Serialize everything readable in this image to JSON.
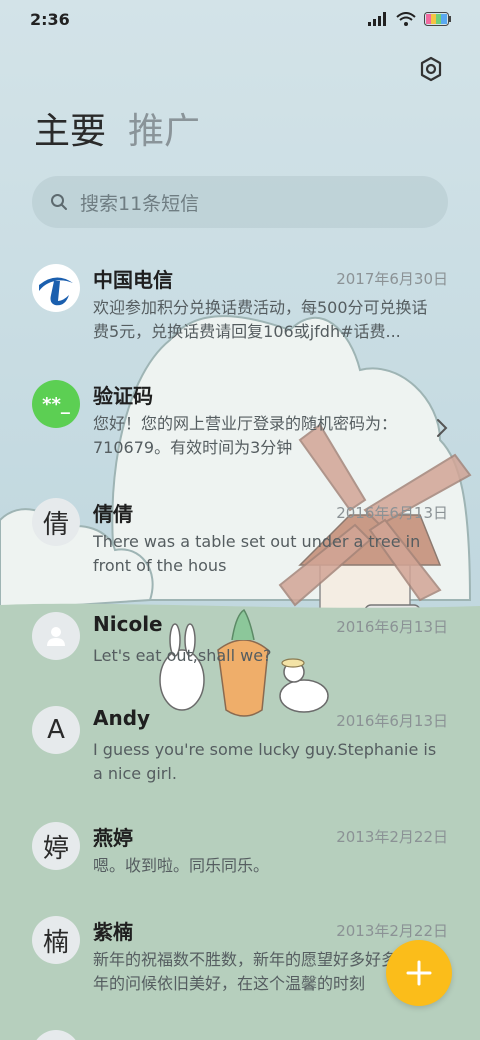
{
  "status_bar": {
    "time": "2:36"
  },
  "tabs": [
    {
      "label": "主要",
      "active": true
    },
    {
      "label": "推广",
      "active": false
    }
  ],
  "search": {
    "placeholder": "搜索11条短信"
  },
  "messages": [
    {
      "sender": "中国电信",
      "date": "2017年6月30日",
      "preview": "欢迎参加积分兑换话费活动，每500分可兑换话费5元，兑换话费请回复106或jfdh#话费...",
      "avatar": "china-telecom-logo"
    },
    {
      "sender": "验证码",
      "date": "",
      "preview": "您好！您的网上营业厅登录的随机密码为：710679。有效时间为3分钟",
      "avatar_text": "**_"
    },
    {
      "sender": "倩倩",
      "date": "2016年6月13日",
      "preview": "There was a table set out under a tree in front of the hous",
      "avatar_text": "倩"
    },
    {
      "sender": "Nicole",
      "date": "2016年6月13日",
      "preview": "Let's eat out,shall we?",
      "avatar": "person-icon"
    },
    {
      "sender": "Andy",
      "date": "2016年6月13日",
      "preview": "I guess you're some lucky guy.Stephanie is a nice girl.",
      "avatar_text": "A"
    },
    {
      "sender": "燕婷",
      "date": "2013年2月22日",
      "preview": "嗯。收到啦。同乐同乐。",
      "avatar_text": "婷"
    },
    {
      "sender": "紫楠",
      "date": "2013年2月22日",
      "preview": "新年的祝福数不胜数，新年的愿望好多好多，新年的问候依旧美好，在这个温馨的时刻",
      "avatar_text": "楠"
    }
  ],
  "colors": {
    "accent_fab": "#fbbd1a",
    "verify_avatar": "#5ccf53",
    "telecom_blue": "#1b5fae"
  }
}
